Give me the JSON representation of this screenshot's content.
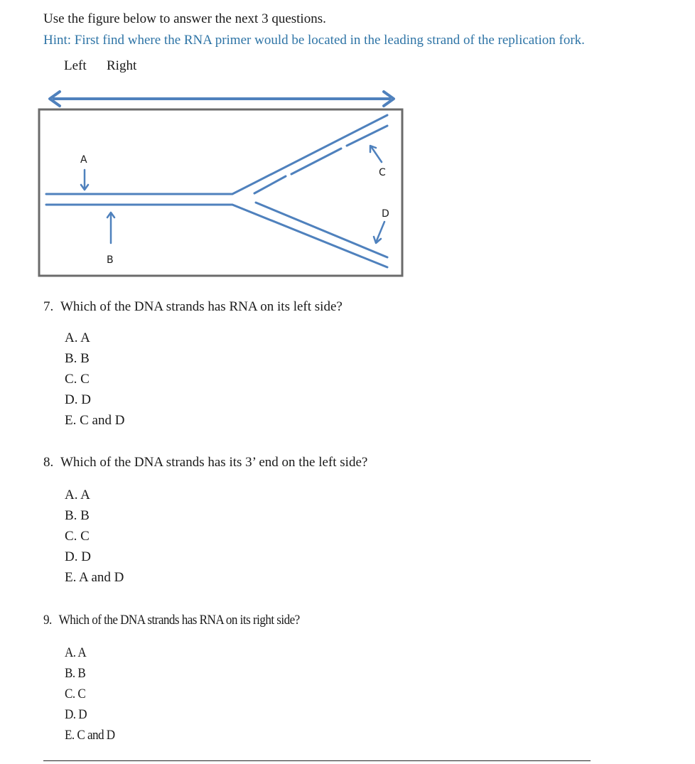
{
  "intro": "Use the figure below to answer the next 3 questions.",
  "hint": "Hint: First find where the RNA primer would be located in the leading strand of the replication fork.",
  "direction_labels": {
    "left": "Left",
    "right": "Right"
  },
  "figure": {
    "description": "DNA replication fork diagram",
    "strand_labels": {
      "A": "A",
      "B": "B",
      "C": "C",
      "D": "D"
    },
    "colors": {
      "strand": "#4f81bd",
      "border": "#6b6b6b",
      "label": "#1a1a1a"
    }
  },
  "questions": [
    {
      "number": "7.",
      "text": "Which of the DNA strands has RNA on its left side?",
      "options": [
        "A. A",
        "B. B",
        "C. C",
        "D. D",
        "E. C and D"
      ]
    },
    {
      "number": "8.",
      "text": "Which of the DNA strands has its 3’ end on the left side?",
      "options": [
        "A. A",
        "B. B",
        "C. C",
        "D. D",
        "E. A and D"
      ]
    },
    {
      "number": "9.",
      "text": "Which of the DNA strands has RNA on its right side?",
      "options": [
        "A. A",
        "B. B",
        "C. C",
        "D. D",
        "E. C and D"
      ]
    }
  ]
}
